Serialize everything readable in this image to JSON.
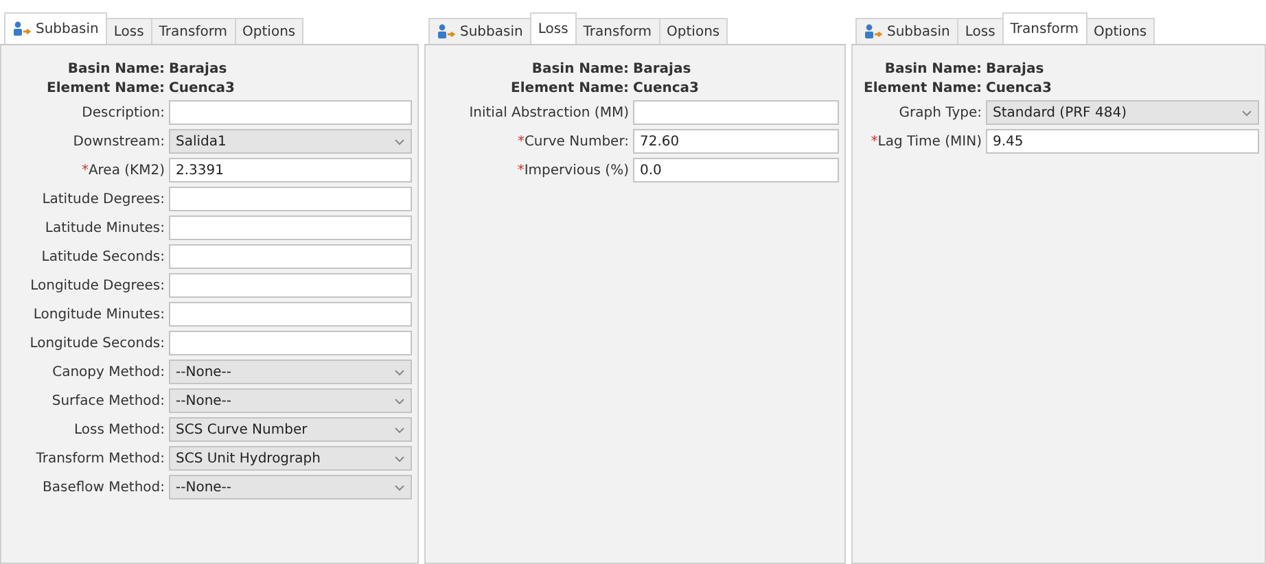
{
  "panels": [
    {
      "tabs": [
        {
          "label": "Subbasin",
          "icon": true,
          "selected": true
        },
        {
          "label": "Loss",
          "selected": false
        },
        {
          "label": "Transform",
          "selected": false
        },
        {
          "label": "Options",
          "selected": false
        }
      ],
      "header": [
        {
          "label": "Basin Name:",
          "value": "Barajas"
        },
        {
          "label": "Element Name:",
          "value": "Cuenca3"
        }
      ],
      "fields": [
        {
          "label": "Description:",
          "kind": "text"
        },
        {
          "label": "Downstream:",
          "kind": "dropdown",
          "value": "Salida1"
        },
        {
          "label": "Area (KM2)",
          "marker": "*",
          "kind": "text",
          "value": "2.3391"
        },
        {
          "label": "Latitude Degrees:",
          "kind": "text"
        },
        {
          "label": "Latitude Minutes:",
          "kind": "text"
        },
        {
          "label": "Latitude Seconds:",
          "kind": "text"
        },
        {
          "label": "Longitude Degrees:",
          "kind": "text"
        },
        {
          "label": "Longitude Minutes:",
          "kind": "text"
        },
        {
          "label": "Longitude Seconds:",
          "kind": "text"
        },
        {
          "label": "Canopy Method:",
          "kind": "dropdown",
          "value": "--None--"
        },
        {
          "label": "Surface Method:",
          "kind": "dropdown",
          "value": "--None--"
        },
        {
          "label": "Loss Method:",
          "kind": "dropdown",
          "value": "SCS Curve Number"
        },
        {
          "label": "Transform Method:",
          "kind": "dropdown",
          "value": "SCS Unit Hydrograph"
        },
        {
          "label": "Baseflow Method:",
          "kind": "dropdown",
          "value": "--None--"
        }
      ]
    },
    {
      "tabs": [
        {
          "label": "Subbasin",
          "icon": true,
          "selected": false
        },
        {
          "label": "Loss",
          "selected": true
        },
        {
          "label": "Transform",
          "selected": false
        },
        {
          "label": "Options",
          "selected": false
        }
      ],
      "header": [
        {
          "label": "Basin Name:",
          "value": "Barajas"
        },
        {
          "label": "Element Name:",
          "value": "Cuenca3"
        }
      ],
      "fields": [
        {
          "label": "Initial Abstraction (MM)",
          "kind": "text"
        },
        {
          "label": "Curve Number:",
          "marker": "*",
          "kind": "text",
          "value": "72.60"
        },
        {
          "label": "Impervious (%)",
          "marker": "*",
          "kind": "text",
          "value": "0.0"
        }
      ]
    },
    {
      "tabs": [
        {
          "label": "Subbasin",
          "icon": true,
          "selected": false
        },
        {
          "label": "Loss",
          "selected": false
        },
        {
          "label": "Transform",
          "selected": true
        },
        {
          "label": "Options",
          "selected": false
        }
      ],
      "header": [
        {
          "label": "Basin Name:",
          "value": "Barajas"
        },
        {
          "label": "Element Name:",
          "value": "Cuenca3"
        }
      ],
      "fields": [
        {
          "label": "Graph Type:",
          "kind": "dropdown",
          "value": "Standard (PRF 484)"
        },
        {
          "label": "Lag Time (MIN)",
          "marker": "*",
          "kind": "text",
          "value": "9.45"
        }
      ]
    }
  ]
}
